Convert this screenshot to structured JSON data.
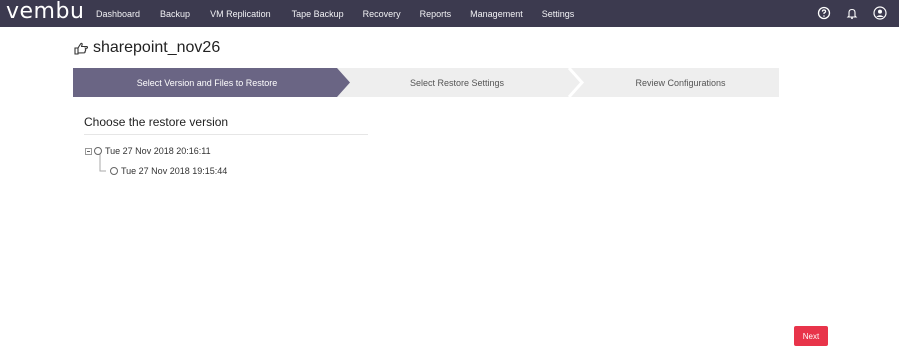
{
  "app": {
    "logo": "vembu"
  },
  "nav": {
    "items": [
      {
        "label": "Dashboard"
      },
      {
        "label": "Backup"
      },
      {
        "label": "VM Replication"
      },
      {
        "label": "Tape Backup"
      },
      {
        "label": "Recovery"
      },
      {
        "label": "Reports"
      },
      {
        "label": "Management"
      },
      {
        "label": "Settings"
      }
    ],
    "icons": [
      "help-icon",
      "bell-icon",
      "user-icon"
    ]
  },
  "page": {
    "title": "sharepoint_nov26"
  },
  "wizard": {
    "steps": [
      {
        "label": "Select Version and Files to Restore",
        "active": true
      },
      {
        "label": "Select Restore Settings",
        "active": false
      },
      {
        "label": "Review Configurations",
        "active": false
      }
    ],
    "colors": {
      "active": "#6a6584",
      "inactive": "#eeeeee"
    }
  },
  "restore": {
    "heading": "Choose the restore version",
    "versions": [
      {
        "label": "Tue 27 Nov 2018 20:16:11"
      },
      {
        "label": "Tue 27 Nov 2018 19:15:44"
      }
    ]
  },
  "actions": {
    "next_label": "Next"
  },
  "colors": {
    "topbar": "#3c3a4f",
    "accent": "#e8344a"
  }
}
